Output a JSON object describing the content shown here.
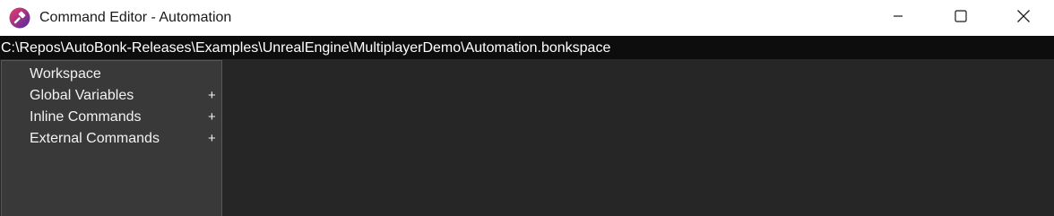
{
  "window": {
    "title": "Command Editor - Automation",
    "icons": {
      "app": "autobonk-app-icon",
      "minimize": "minimize-icon",
      "maximize": "maximize-icon",
      "close": "close-icon"
    }
  },
  "path_bar": {
    "path": "C:\\Repos\\AutoBonk-Releases\\Examples\\UnrealEngine\\MultiplayerDemo\\Automation.bonkspace"
  },
  "tree": {
    "items": [
      {
        "label": "Workspace",
        "expander": ""
      },
      {
        "label": "Global Variables",
        "expander": "+"
      },
      {
        "label": "Inline Commands",
        "expander": "+"
      },
      {
        "label": "External Commands",
        "expander": "+"
      }
    ]
  },
  "colors": {
    "accent_gradient_start": "#e0245e",
    "accent_gradient_end": "#5b2a9e",
    "background": "#262626",
    "panel": "#393939"
  }
}
